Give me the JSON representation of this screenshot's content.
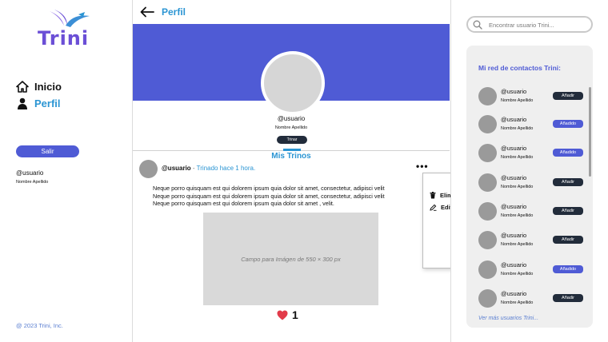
{
  "brand": {
    "name": "Trini",
    "logo_color": "#6b4fd6"
  },
  "sidebar": {
    "nav": [
      {
        "label": "Inicio",
        "icon": "home-icon"
      },
      {
        "label": "Perfil",
        "icon": "user-icon"
      }
    ],
    "logout_label": "Salir",
    "user": "@usuario",
    "fullname": "Nombre Apellido",
    "copyright": "@ 2023 Trini, Inc."
  },
  "main": {
    "title": "Perfil",
    "profile": {
      "user": "@usuario",
      "fullname": "Nombre Apellido",
      "trinar_label": "Trinar"
    },
    "tab_label": "Mis Trinos",
    "post": {
      "user": "@usuario",
      "separator": " - ",
      "meta": "Trinado hace 1 hora.",
      "more": "•••",
      "lines": [
        "Neque porro quisquam est qui dolorem ipsum quia dolor sit amet, consectetur, adipisci velit",
        "Neque porro quisquam est qui dolorem ipsum quia dolor sit amet, consectetur, adipisci velit",
        "Neque porro quisquam est qui dolorem ipsum quia dolor sit amet , velit."
      ],
      "image_placeholder": "Campo para Imágen de 550 × 300 px",
      "likes": "1"
    },
    "menu": {
      "close": "✕",
      "delete_label": "Eliminar",
      "edit_label": "Editar"
    }
  },
  "right": {
    "search_placeholder": "Encontrar usuario Trini...",
    "contacts_title": "Mi red de contactos Trini:",
    "contacts": [
      {
        "user": "@usuario",
        "fullname": "Nombre Apellido",
        "button": "Añadir",
        "state": "add"
      },
      {
        "user": "@usuario",
        "fullname": "Nombre Apellido",
        "button": "Añadido",
        "state": "added"
      },
      {
        "user": "@usuario",
        "fullname": "Nombre Apellido",
        "button": "Añadido",
        "state": "added"
      },
      {
        "user": "@usuario",
        "fullname": "Nombre Apellido",
        "button": "Añadir",
        "state": "add"
      },
      {
        "user": "@usuario",
        "fullname": "Nombre Apellido",
        "button": "Añadir",
        "state": "add"
      },
      {
        "user": "@usuario",
        "fullname": "Nombre Apellido",
        "button": "Añadir",
        "state": "add"
      },
      {
        "user": "@usuario",
        "fullname": "Nombre Apellido",
        "button": "Añadido",
        "state": "added"
      },
      {
        "user": "@usuario",
        "fullname": "Nombre Apellido",
        "button": "Añadir",
        "state": "add"
      }
    ],
    "more_link": "Ver más usuarios Trini..."
  },
  "colors": {
    "accent": "#4f5bd5",
    "link": "#2b95d3",
    "dark_button": "#222c3b",
    "like": "#e23b4a"
  }
}
